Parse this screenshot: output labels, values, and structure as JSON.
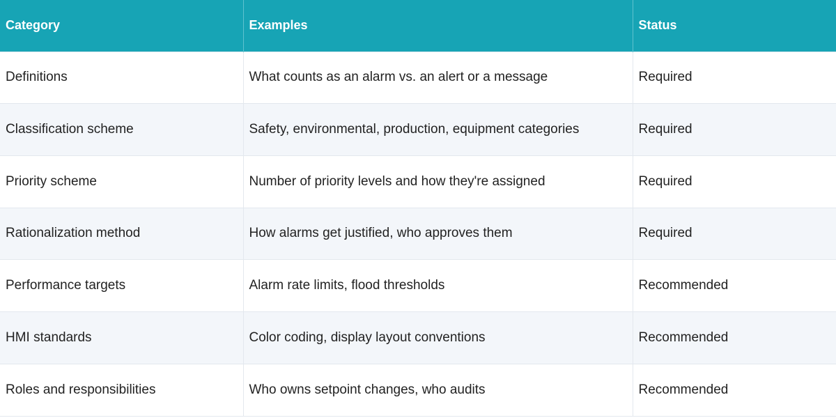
{
  "table": {
    "headers": [
      "Category",
      "Examples",
      "Status"
    ],
    "rows": [
      [
        "Definitions",
        "What counts as an alarm vs. an alert or a message",
        "Required"
      ],
      [
        "Classification scheme",
        "Safety, environmental, production, equipment categories",
        "Required"
      ],
      [
        "Priority scheme",
        "Number of priority levels and how they're assigned",
        "Required"
      ],
      [
        "Rationalization method",
        "How alarms get justified, who approves them",
        "Required"
      ],
      [
        "Performance targets",
        "Alarm rate limits, flood thresholds",
        "Recommended"
      ],
      [
        "HMI standards",
        "Color coding, display layout conventions",
        "Recommended"
      ],
      [
        "Roles and responsibilities",
        "Who owns setpoint changes, who audits",
        "Recommended"
      ]
    ]
  },
  "colors": {
    "header_bg": "#17a4b5",
    "header_text": "#ffffff",
    "row_alt_bg": "#f3f6fa",
    "border": "#e3e8ee"
  }
}
